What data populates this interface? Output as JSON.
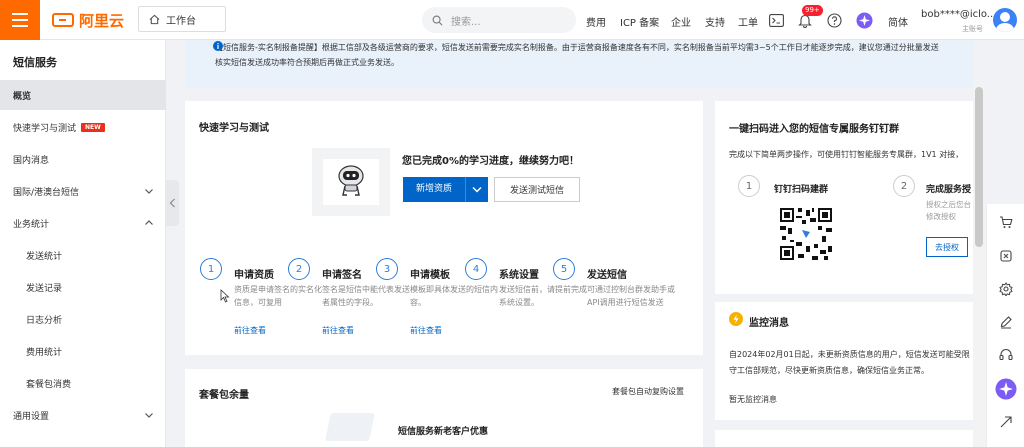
{
  "topbar": {
    "logo_text": "阿里云",
    "workbench": "工作台",
    "search_placeholder": "搜索...",
    "nav": [
      "费用",
      "ICP 备案",
      "企业",
      "支持",
      "工单"
    ],
    "notification_count": "99+",
    "language": "简体",
    "user_name": "bob****@iclo...",
    "user_role": "主账号"
  },
  "sidebar": {
    "title": "短信服务",
    "items": [
      {
        "label": "概览",
        "active": true
      },
      {
        "label": "快速学习与测试",
        "badge": "NEW"
      },
      {
        "label": "国内消息"
      },
      {
        "label": "国际/港澳台短信",
        "chevron": "down"
      },
      {
        "label": "业务统计",
        "chevron": "up"
      },
      {
        "label": "发送统计",
        "sub": true
      },
      {
        "label": "发送记录",
        "sub": true
      },
      {
        "label": "日志分析",
        "sub": true
      },
      {
        "label": "费用统计",
        "sub": true
      },
      {
        "label": "套餐包消费",
        "sub": true
      },
      {
        "label": "通用设置",
        "chevron": "down"
      }
    ]
  },
  "notice": {
    "text": "【短信服务-实名制报备提醒】根据工信部及各级运营商的要求，短信发送前需要完成实名制报备。由于运营商报备速度各有不同，实名制报备当前平均需3~5个工作日才能逐步完成，建议您通过分批量发送核实短信发送成功率符合预期后再做正式业务发送。"
  },
  "quick_learn": {
    "title": "快速学习与测试",
    "progress_text": "您已完成0%的学习进度，继续努力吧！",
    "primary_button": "新增资质",
    "secondary_button": "发送测试短信",
    "steps": [
      {
        "num": "1",
        "title": "申请资质",
        "desc": "资质是申请签名的实名化信息，可复用",
        "link": "前往查看"
      },
      {
        "num": "2",
        "title": "申请签名",
        "desc": "签名是短信中能代表发送者属性的字段。",
        "link": "前往查看"
      },
      {
        "num": "3",
        "title": "申请模板",
        "desc": "模板即具体发送的短信内容。",
        "link": "前往查看"
      },
      {
        "num": "4",
        "title": "系统设置",
        "desc": "发送短信前，请提前完成系统设置。",
        "link": ""
      },
      {
        "num": "5",
        "title": "发送短信",
        "desc": "可通过控制台群发助手或API调用进行短信发送",
        "link": ""
      }
    ]
  },
  "package": {
    "title": "套餐包余量",
    "auto_renew_link": "套餐包自动复购设置",
    "promo_text": "短信服务新老客户优惠"
  },
  "dingtalk": {
    "title": "一键扫码进入您的短信专属服务钉钉群",
    "desc": "完成以下简单两步操作，可使用钉钉智能服务专属群，1V1 对接，",
    "step1_num": "1",
    "step1_title": "钉钉扫码建群",
    "step2_num": "2",
    "step2_title": "完成服务授",
    "step2_desc": "授权之后您台修改授权",
    "auth_button": "去授权"
  },
  "monitor": {
    "title": "监控消息",
    "text_line1": "自2024年02月01日起，未更新资质信息的用户，短信发送可能受限",
    "text_line2": "守工信部规范，尽快更新资质信息，确保短信业务正常。",
    "empty": "暂无监控消息"
  },
  "floatbar": {
    "icons": [
      "cart-icon",
      "share-icon",
      "settings-icon",
      "edit-icon",
      "headset-icon",
      "assistant-icon",
      "collapse-icon"
    ]
  }
}
